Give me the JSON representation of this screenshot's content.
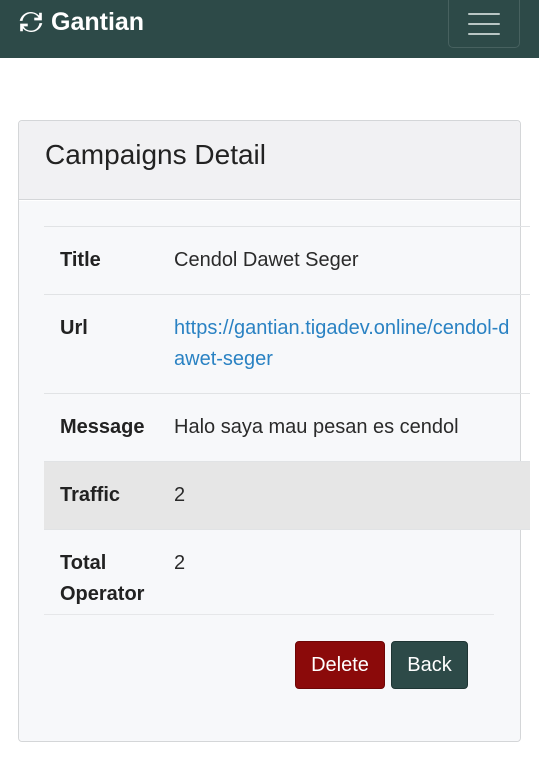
{
  "navbar": {
    "brand": "Gantian",
    "brand_icon": "sync-icon",
    "toggle_icon": "hamburger-menu-icon",
    "color": "#2d4a48"
  },
  "card": {
    "title": "Campaigns Detail"
  },
  "details": {
    "rows": [
      {
        "label": "Title",
        "value": "Cendol Dawet Seger"
      },
      {
        "label": "Url",
        "value": "https://gantian.tigadev.online/cendol-dawet-seger"
      },
      {
        "label": "Message",
        "value": "Halo saya mau pesan es cendol"
      },
      {
        "label": "Traffic",
        "value": "2"
      },
      {
        "label": "Total Operator",
        "value": "2"
      }
    ],
    "link_color": "#2a82c3"
  },
  "actions": {
    "delete_label": "Delete",
    "back_label": "Back",
    "delete_color": "#8b0a0a",
    "back_color": "#2d4a48"
  }
}
